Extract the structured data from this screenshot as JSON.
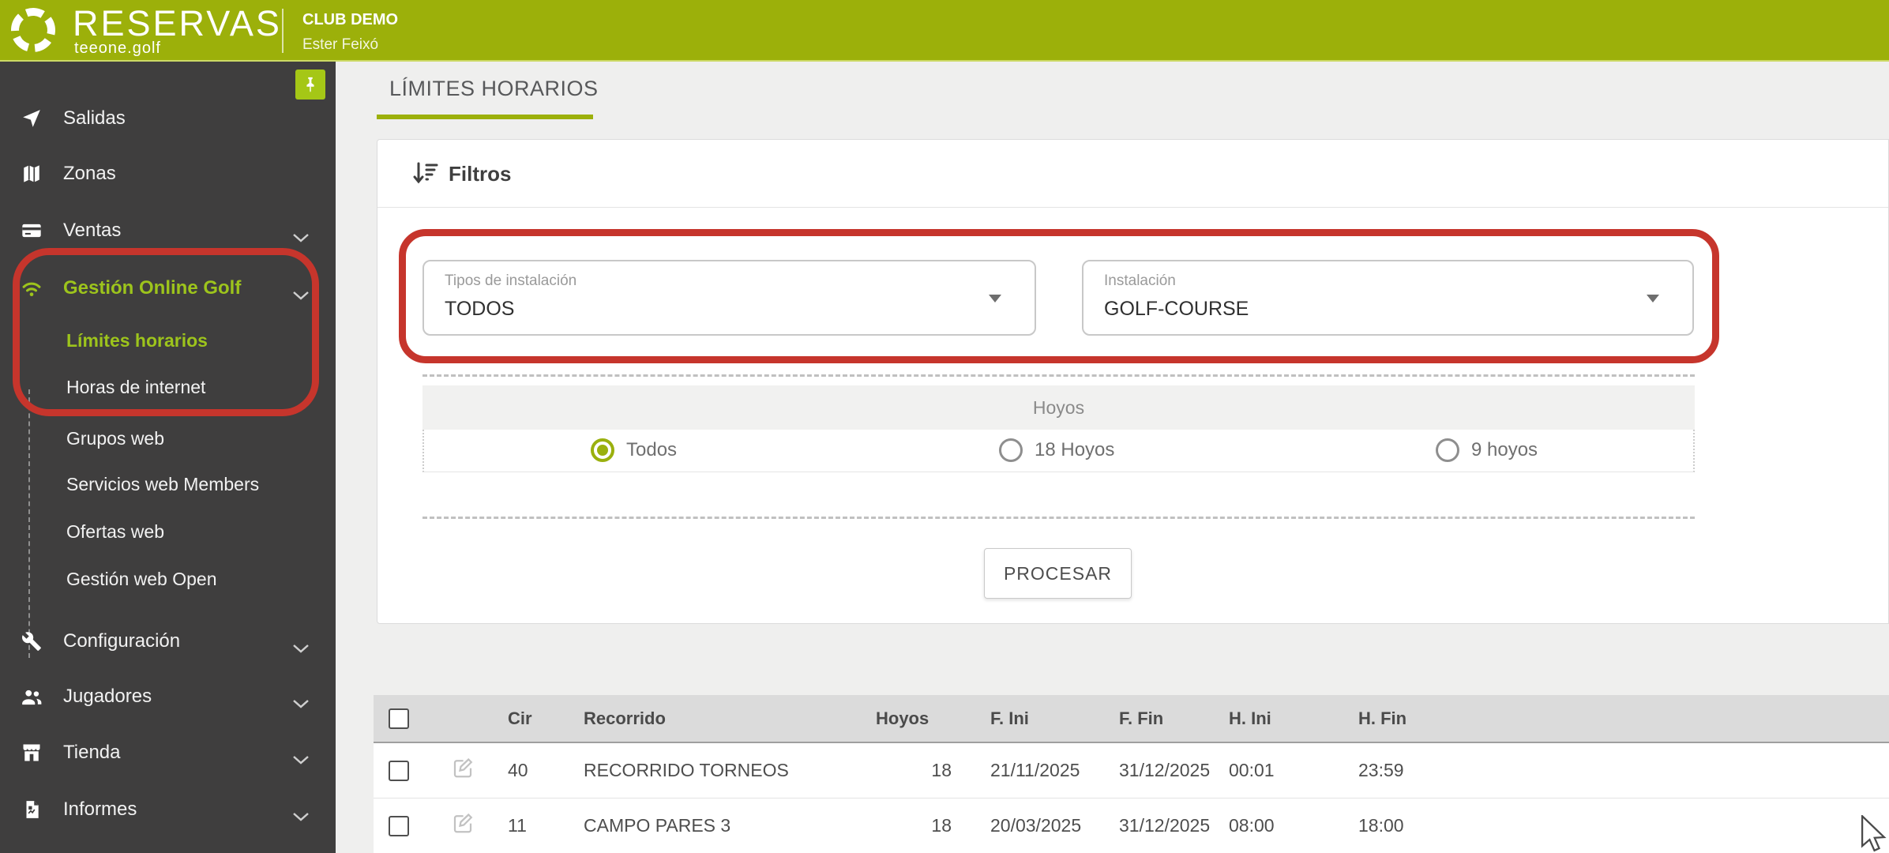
{
  "header": {
    "brand": "RESERVAS",
    "brand_sub": "teeone.golf",
    "club": "CLUB DEMO",
    "user": "Ester Feixó"
  },
  "sidebar": {
    "items": [
      {
        "label": "Salidas",
        "icon": "navigation-icon",
        "chevron": false,
        "active": false
      },
      {
        "label": "Zonas",
        "icon": "map-icon",
        "chevron": false,
        "active": false
      },
      {
        "label": "Ventas",
        "icon": "card-icon",
        "chevron": true,
        "active": false
      },
      {
        "label": "Gestión Online Golf",
        "icon": "wifi-icon",
        "chevron": true,
        "active": true
      },
      {
        "label": "Configuración",
        "icon": "wrench-icon",
        "chevron": true,
        "active": false
      },
      {
        "label": "Jugadores",
        "icon": "users-icon",
        "chevron": true,
        "active": false
      },
      {
        "label": "Tienda",
        "icon": "store-icon",
        "chevron": true,
        "active": false
      },
      {
        "label": "Informes",
        "icon": "report-icon",
        "chevron": true,
        "active": false
      }
    ],
    "submenu": [
      {
        "label": "Límites horarios",
        "active": true
      },
      {
        "label": "Horas de internet",
        "active": false
      },
      {
        "label": "Grupos web",
        "active": false
      },
      {
        "label": "Servicios web Members",
        "active": false
      },
      {
        "label": "Ofertas web",
        "active": false
      },
      {
        "label": "Gestión web Open",
        "active": false
      }
    ]
  },
  "main": {
    "tab": "LÍMITES HORARIOS",
    "filters": {
      "title": "Filtros",
      "type_label": "Tipos de instalación",
      "type_value": "TODOS",
      "installation_label": "Instalación",
      "installation_value": "GOLF-COURSE",
      "holes_header": "Hoyos",
      "holes_options": [
        {
          "label": "Todos",
          "selected": true
        },
        {
          "label": "18 Hoyos",
          "selected": false
        },
        {
          "label": "9 hoyos",
          "selected": false
        }
      ],
      "process_button": "PROCESAR"
    },
    "table": {
      "columns": [
        "Cir",
        "Recorrido",
        "Hoyos",
        "F. Ini",
        "F. Fin",
        "H. Ini",
        "H. Fin"
      ],
      "rows": [
        {
          "cir": "40",
          "recorrido": "RECORRIDO TORNEOS",
          "hoyos": "18",
          "f_ini": "21/11/2025",
          "f_fin": "31/12/2025",
          "h_ini": "00:01",
          "h_fin": "23:59"
        },
        {
          "cir": "11",
          "recorrido": "CAMPO PARES 3",
          "hoyos": "18",
          "f_ini": "20/03/2025",
          "f_fin": "31/12/2025",
          "h_ini": "08:00",
          "h_fin": "18:00"
        }
      ]
    }
  },
  "colors": {
    "header_green": "#9cb00a",
    "pin_green": "#a5c716",
    "active_green": "#9dc41c",
    "annotation_red": "#c6352c",
    "sidebar_bg": "#3f3e3e"
  }
}
